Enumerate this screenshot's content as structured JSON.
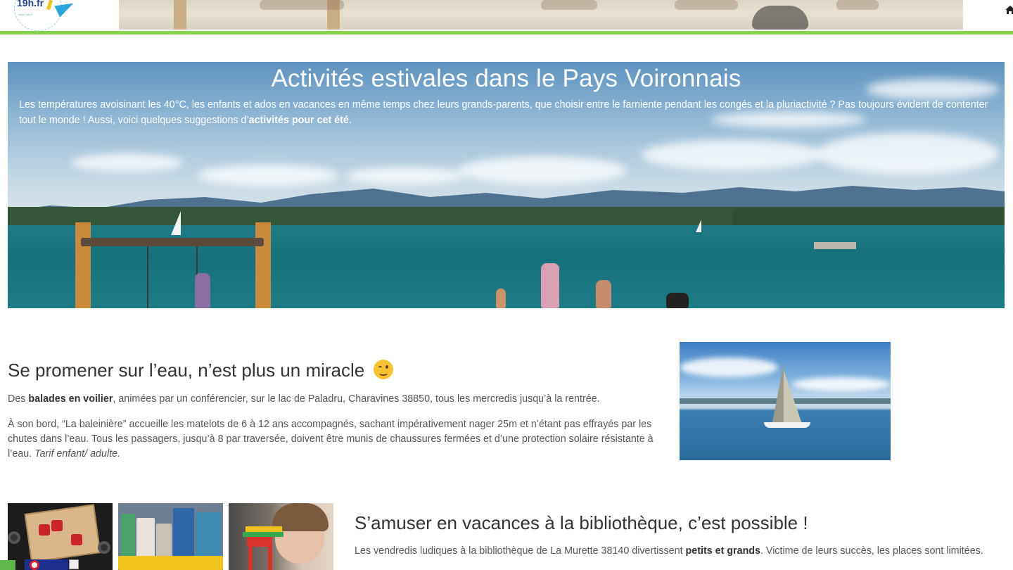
{
  "header": {
    "logo_text": "19h.fr",
    "logo_tagline": "www.19h.fr"
  },
  "hero": {
    "title": "Activités estivales dans le Pays Voironnais",
    "intro_text": "Les températures avoisinant les 40°C, les enfants et ados en vacances en même temps chez leurs grands-parents, que choisir entre le farniente pendant les congés et la pluriactivité ? Pas toujours évident de contenter tout le monde ! Aussi, voici quelques suggestions d’",
    "intro_bold": "activités pour cet été",
    "intro_end": "."
  },
  "section_boat": {
    "title": "Se promener sur l’eau, n’est plus un miracle",
    "p1_start": "Des ",
    "p1_bold": "balades en voilier",
    "p1_end": ", animées par un conférencier, sur le lac de Paladru, Charavines 38850, tous les mercredis jusqu’à la rentrée.",
    "p2_start": "À son bord, “La baleinière” accueille les matelots de 6 à 12 ans accompagnés,  sachant impérativement nager 25m et n’étant pas effrayés par les chutes dans l’eau. Tous les passagers, jusqu’à 8 par traversée, doivent être munis de chaussures fermées et d’une protection solaire résistante à l’eau. ",
    "p2_italic": "Tarif enfant/ adulte."
  },
  "section_library": {
    "title": "S’amuser en vacances à la bibliothèque, c’est possible !",
    "p1_start": "Les vendredis ludiques à la bibliothèque de La Murette 38140 divertissent ",
    "p1_bold": "petits et grands",
    "p1_end": ". Victime de leurs succès, les places sont limitées."
  },
  "colors": {
    "accent_green": "#86d24a",
    "logo_blue": "#1f3f8c"
  },
  "icons": {
    "emoji": "winking-face-icon",
    "nav": "home-icon"
  }
}
